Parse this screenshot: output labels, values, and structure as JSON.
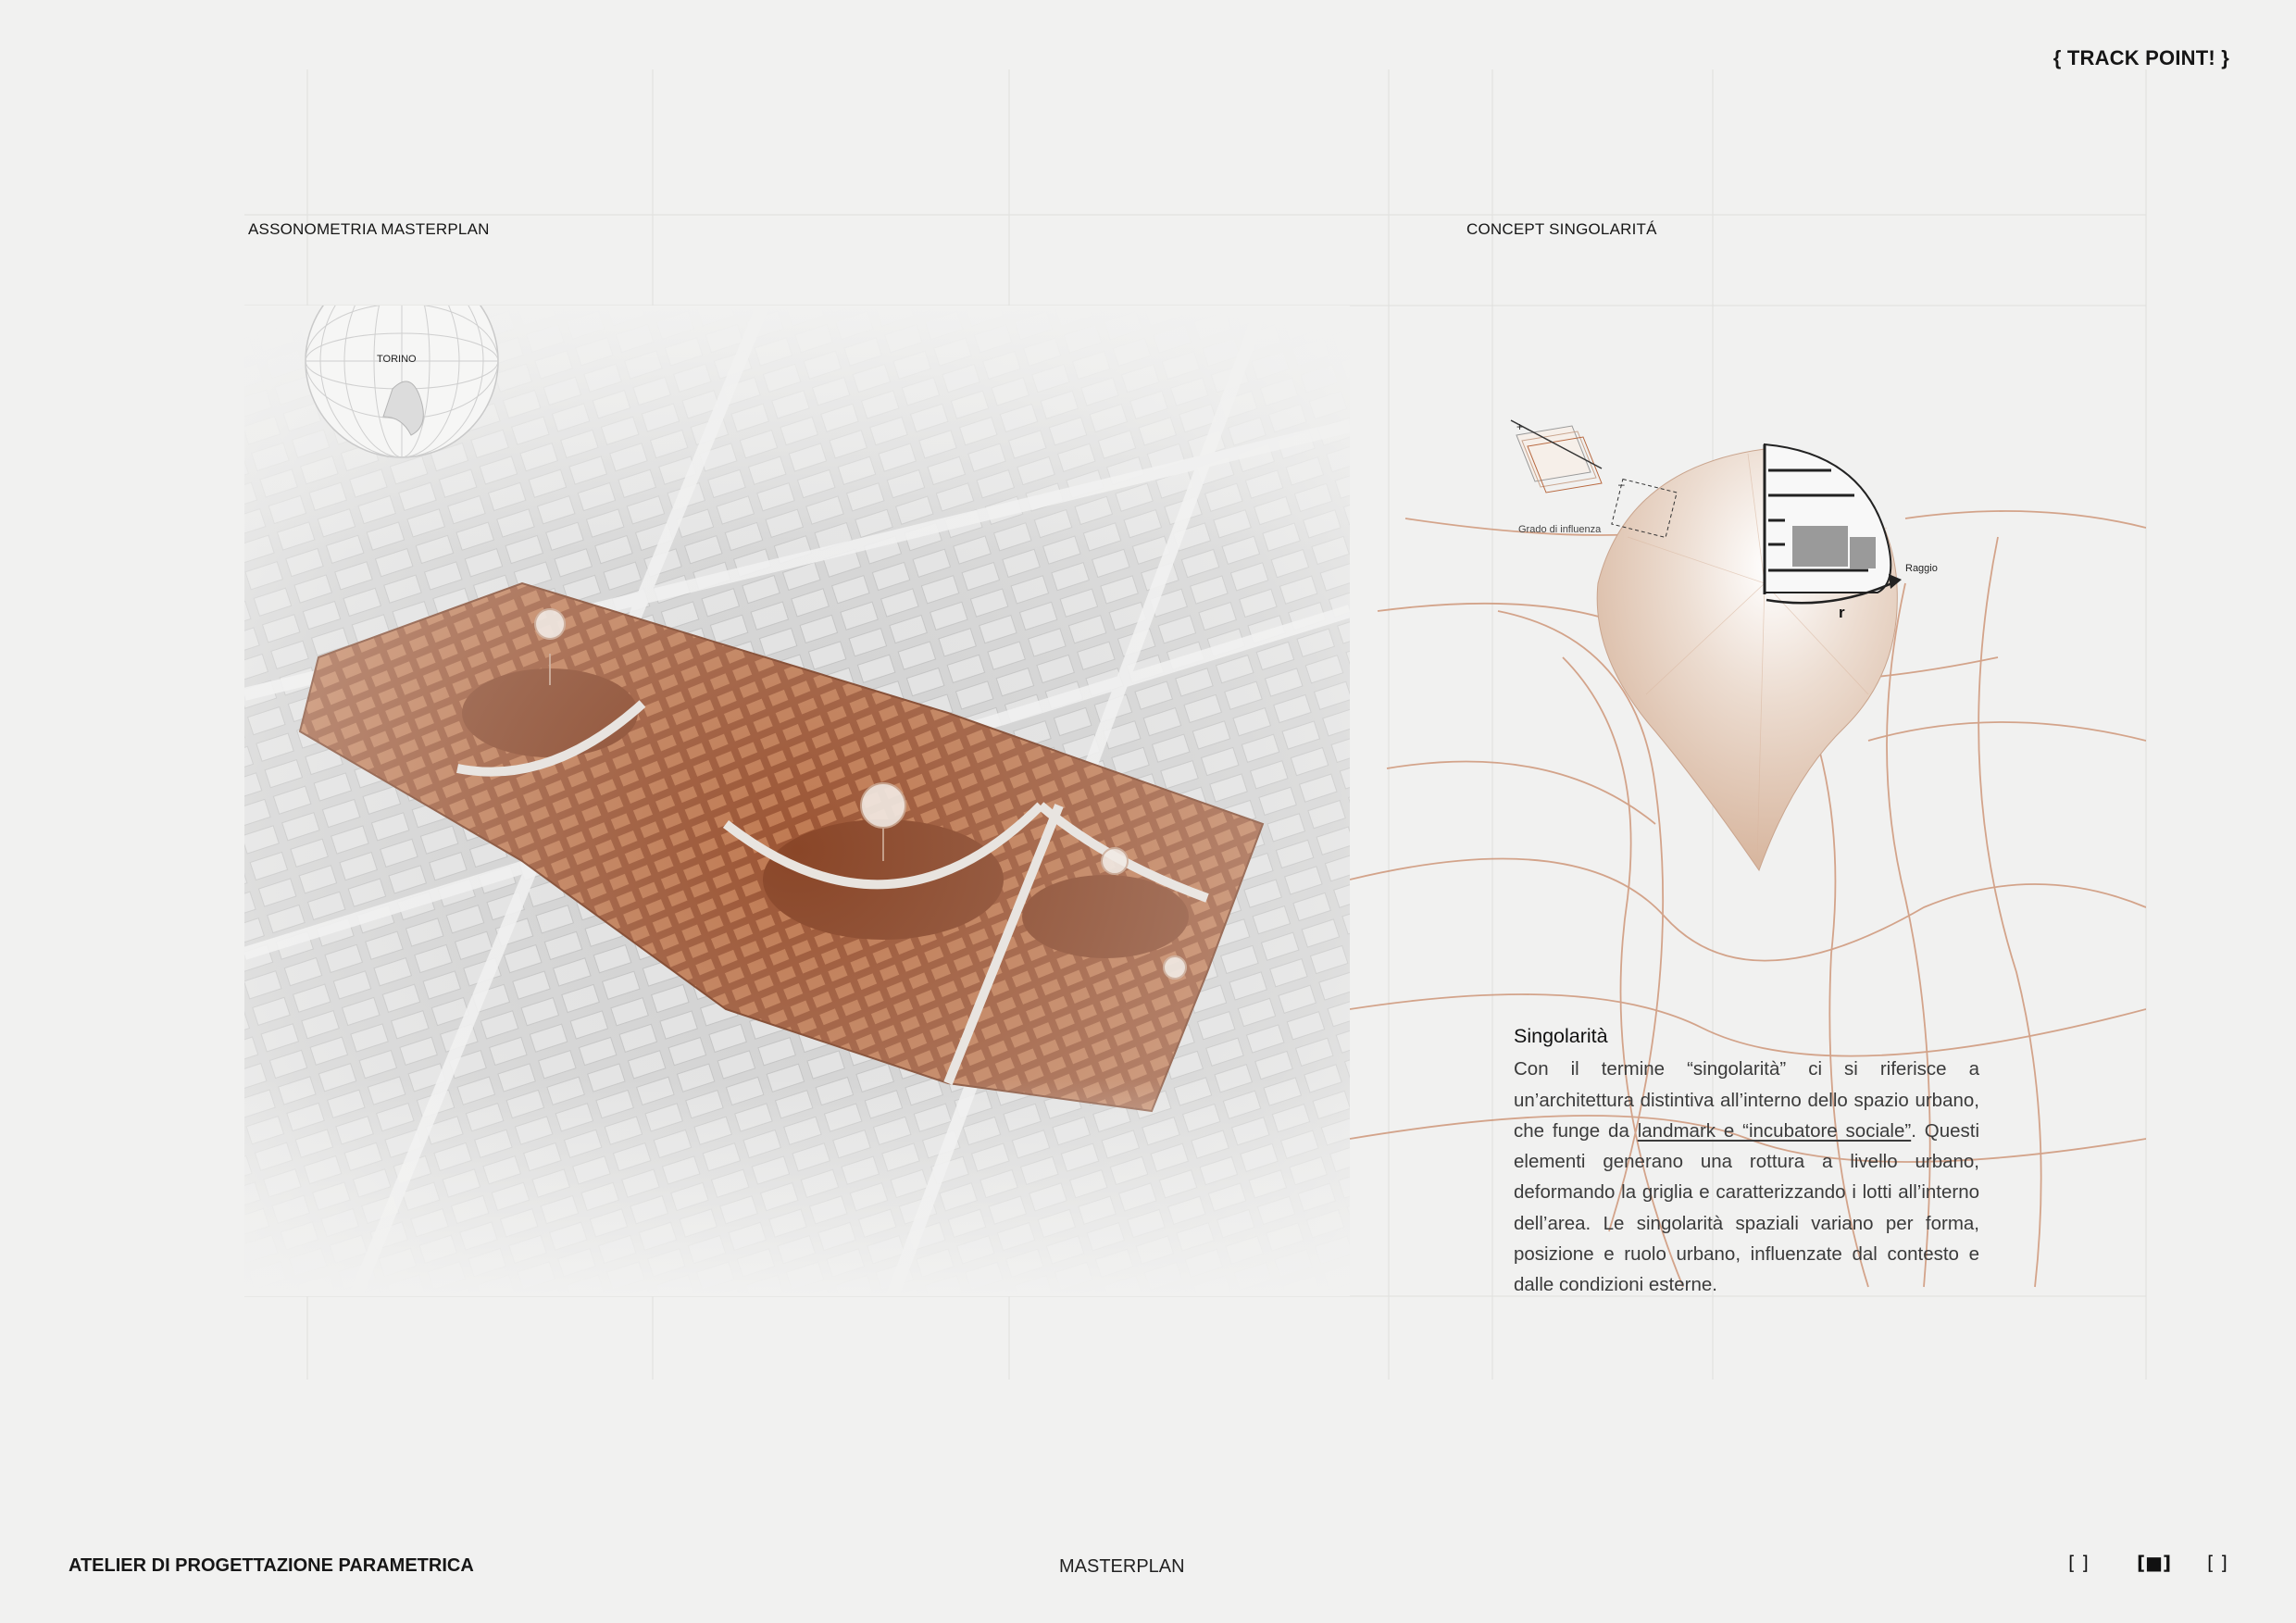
{
  "header": {
    "brand": "{ TRACK POINT! }"
  },
  "labels": {
    "left_title": "ASSONOMETRIA MASTERPLAN",
    "right_title": "CONCEPT SINGOLARITÁ",
    "globe_city": "TORINO",
    "influence": "Grado di influenza",
    "radius_word": "Raggio",
    "radius_symbol": "r",
    "plus": "+",
    "minus": "–"
  },
  "text": {
    "heading": "Singolarità",
    "p_before": "Con il termine “singolarità” ci si riferisce a un’architettura distintiva all’interno dello spazio urbano, che funge da ",
    "p_underline": "landmark e “incubatore sociale”",
    "p_after": ". Questi elementi generano una rottura a livello urbano, deformando la griglia e caratterizzando i lotti all’interno dell’area. Le singolarità spaziali variano per forma, posizione e ruolo urbano, influenzate dal contesto e dalle condizioni esterne."
  },
  "footer": {
    "left": "ATELIER DI PROGETTAZIONE PARAMETRICA",
    "center": "MASTERPLAN",
    "pager": [
      "[ ]",
      "[■]",
      "[ ]"
    ]
  },
  "colors": {
    "accent": "#b8683f",
    "accent_dark": "#8f4a2a",
    "grid": "#c98a68",
    "background": "#f1f1f0"
  }
}
